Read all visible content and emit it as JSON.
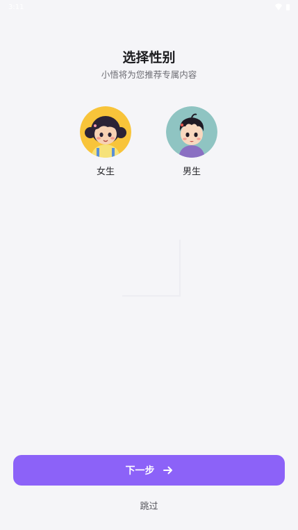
{
  "status_bar": {
    "time": "3:11"
  },
  "header": {
    "title": "选择性别",
    "subtitle": "小悟将为您推荐专属内容"
  },
  "options": [
    {
      "label": "女生",
      "avatar_bg": "#f8c43a",
      "icon": "girl-avatar-icon"
    },
    {
      "label": "男生",
      "avatar_bg": "#8fc4c2",
      "icon": "boy-avatar-icon"
    }
  ],
  "actions": {
    "next_label": "下一步",
    "next_icon": "arrow-right-icon",
    "skip_label": "跳过"
  },
  "colors": {
    "accent": "#8c62f8",
    "background": "#f5f5f8"
  }
}
